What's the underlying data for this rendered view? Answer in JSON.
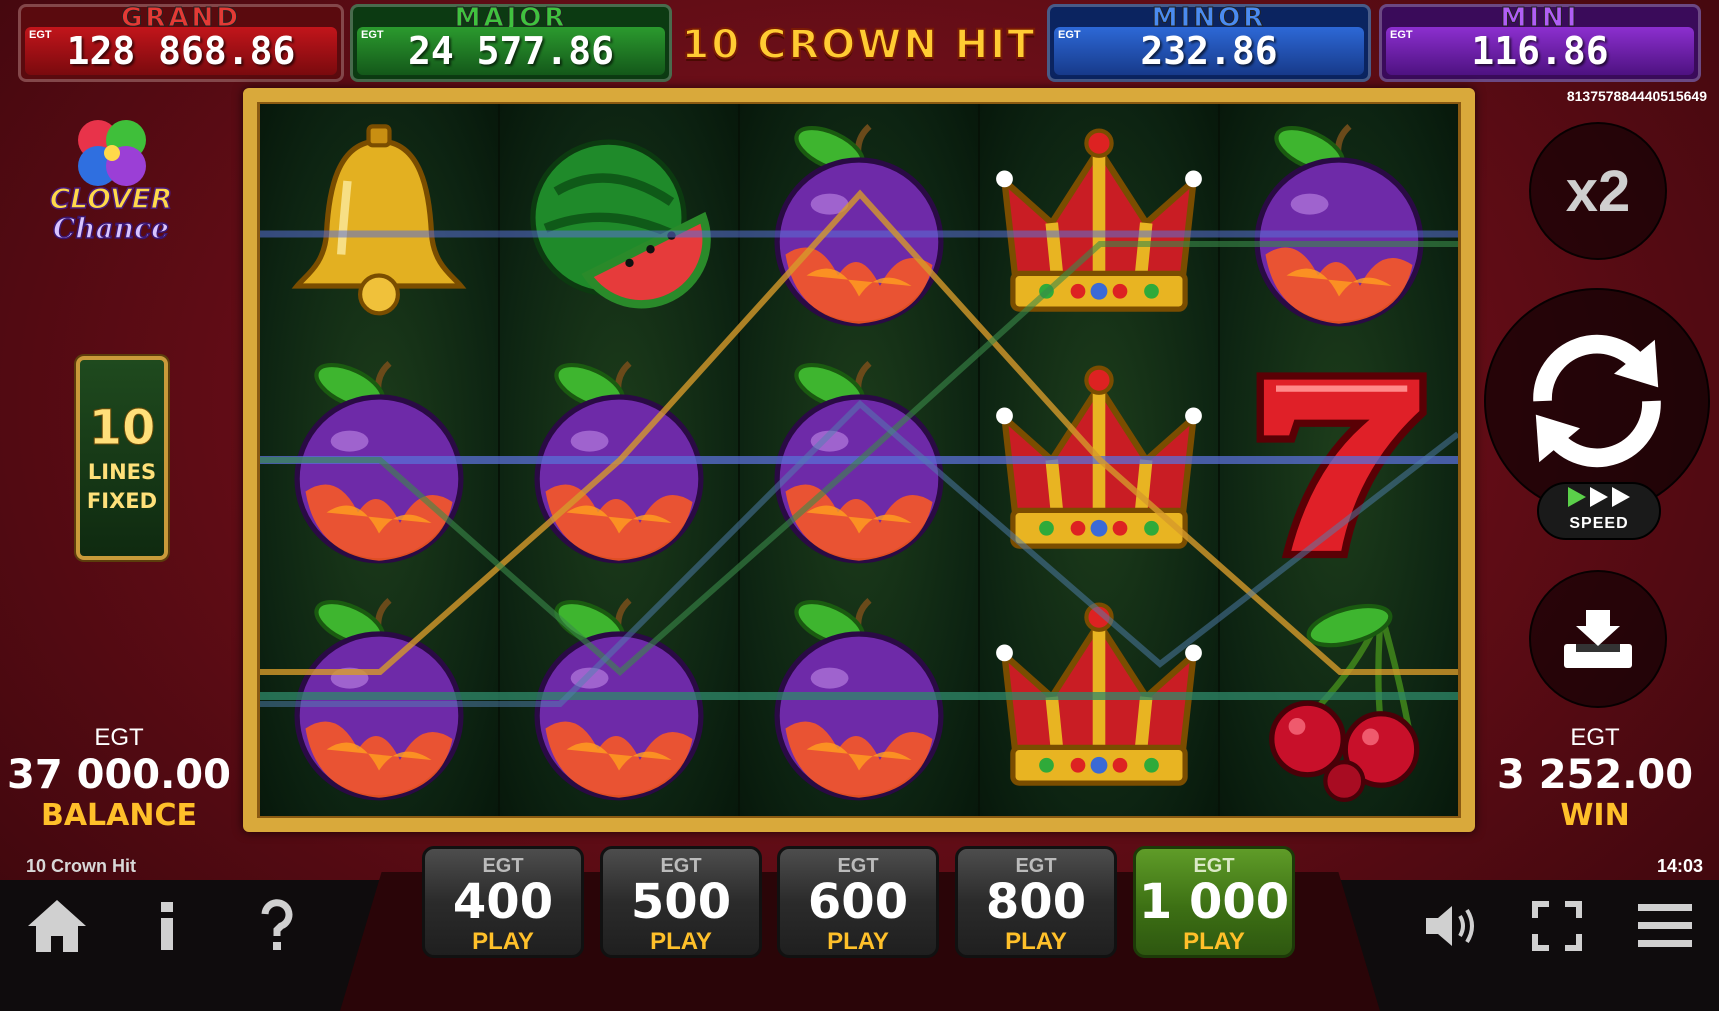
{
  "jackpots": [
    {
      "name": "GRAND",
      "tag": "EGT",
      "value": "128 868.86",
      "color": "#c2151b"
    },
    {
      "name": "MAJOR",
      "tag": "EGT",
      "value": "24 577.86",
      "color": "#2b9a2e"
    },
    {
      "name": "MINOR",
      "tag": "EGT",
      "value": "232.86",
      "color": "#2d68d6"
    },
    {
      "name": "MINI",
      "tag": "EGT",
      "value": "116.86",
      "color": "#8c2fcf"
    }
  ],
  "game_title": "10 CROWN HIT",
  "game_id": "813757884440515649",
  "logo": {
    "line1": "CLOVER",
    "line2": "Chance"
  },
  "lines": {
    "number": "10",
    "label1": "LINES",
    "label2": "FIXED"
  },
  "balance": {
    "currency": "EGT",
    "amount": "37 000.00",
    "label": "BALANCE"
  },
  "win": {
    "currency": "EGT",
    "amount": "3 252.00",
    "label": "WIN"
  },
  "controls": {
    "multiplier": "x2",
    "speed_label": "SPEED"
  },
  "reels": [
    [
      "bell",
      "plum",
      "plum"
    ],
    [
      "watermelon",
      "plum",
      "plum"
    ],
    [
      "plum",
      "plum",
      "plum"
    ],
    [
      "crown",
      "crown",
      "crown"
    ],
    [
      "plum",
      "seven",
      "cherry"
    ]
  ],
  "footer": {
    "game_name": "10 Crown Hit",
    "clock": "14:03"
  },
  "bets": [
    {
      "tag": "EGT",
      "value": "400",
      "label": "PLAY",
      "active": false
    },
    {
      "tag": "EGT",
      "value": "500",
      "label": "PLAY",
      "active": false
    },
    {
      "tag": "EGT",
      "value": "600",
      "label": "PLAY",
      "active": false
    },
    {
      "tag": "EGT",
      "value": "800",
      "label": "PLAY",
      "active": false
    },
    {
      "tag": "EGT",
      "value": "1 000",
      "label": "PLAY",
      "active": true
    }
  ],
  "colors": {
    "accent_gold": "#ffc02a",
    "background": "#5e0c15",
    "active_bet": "#3d7014"
  }
}
